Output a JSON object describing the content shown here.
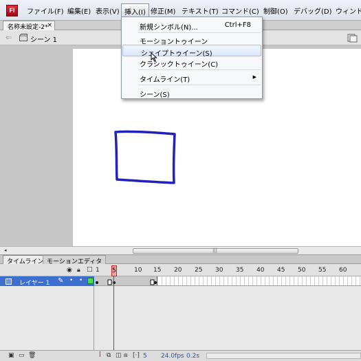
{
  "menubar": {
    "app_logo": "Fl",
    "items": [
      "ファイル(F)",
      "編集(E)",
      "表示(V)",
      "挿入(I)",
      "修正(M)",
      "テキスト(T)",
      "コマンド(C)",
      "制御(O)",
      "デバッグ(D)",
      "ウィンド"
    ]
  },
  "document": {
    "tab_label": "名称未設定-2*",
    "close_glyph": "×",
    "scene_label": "シーン 1"
  },
  "insert_menu": {
    "new_symbol": "新規シンボル(N)...",
    "new_symbol_shortcut": "Ctrl+F8",
    "motion_tween": "モーショントゥイーン",
    "shape_tween": "シェイプトゥイーン(S)",
    "classic_tween": "クラシックトゥイーン(C)",
    "timeline": "タイムライン(T)",
    "scene": "シーン(S)",
    "highlighted": "shape_tween"
  },
  "timeline": {
    "tabs": [
      "タイムライン",
      "モーションエディタ"
    ],
    "layer_name": "レイヤー 1",
    "ruler_labels": [
      "1",
      "5",
      "10",
      "15",
      "20",
      "25",
      "30",
      "35",
      "40",
      "45",
      "50",
      "55",
      "60"
    ],
    "current_frame": "5",
    "footer": {
      "frame": "5",
      "fps": "24.0fps",
      "time": "0.2s"
    }
  },
  "colors": {
    "stroke": "#2222bb",
    "layer_outline": "#47e24a",
    "layer_selected": "#3c6fd0",
    "playhead": "#e01c1c"
  },
  "icons": [
    "app-logo-icon",
    "close-icon",
    "back-arrow-icon",
    "scene-icon",
    "eye-icon",
    "lock-icon",
    "outline-icon",
    "layer-icon",
    "pencil-icon",
    "submenu-arrow-icon",
    "mouse-cursor-icon",
    "new-layer-icon",
    "new-folder-icon",
    "delete-layer-icon"
  ]
}
